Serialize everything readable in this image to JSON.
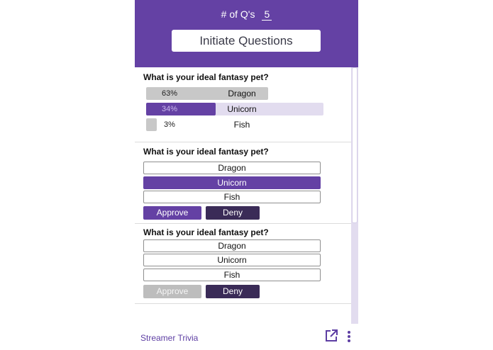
{
  "header": {
    "question_count_label": "# of Q's",
    "question_count_value": "5",
    "initiate_button": "Initiate Questions"
  },
  "cards": [
    {
      "question": "What is your ideal fantasy pet?",
      "results": [
        {
          "percent_label": "63%",
          "answer": "Dragon",
          "percent": 63
        },
        {
          "percent_label": "34%",
          "answer": "Unicorn",
          "percent": 34
        },
        {
          "percent_label": "3%",
          "answer": "Fish",
          "percent": 3
        }
      ]
    },
    {
      "question": "What is your ideal fantasy pet?",
      "options": [
        "Dragon",
        "Unicorn",
        "Fish"
      ],
      "selected_option": "Unicorn",
      "approve_label": "Approve",
      "deny_label": "Deny",
      "approve_enabled": true
    },
    {
      "question": "What is your ideal fantasy pet?",
      "options": [
        "Dragon",
        "Unicorn",
        "Fish"
      ],
      "selected_option": "",
      "approve_label": "Approve",
      "deny_label": "Deny",
      "approve_enabled": false
    }
  ],
  "footer": {
    "title": "Streamer Trivia",
    "popout_icon": "popout-icon",
    "menu_icon": "vertical-dots-icon"
  },
  "colors": {
    "brand_purple": "#6441a4",
    "deny_dark": "#3a2b57",
    "highlight_light": "#e2dcef",
    "neutral_gray": "#c8c8c8"
  }
}
